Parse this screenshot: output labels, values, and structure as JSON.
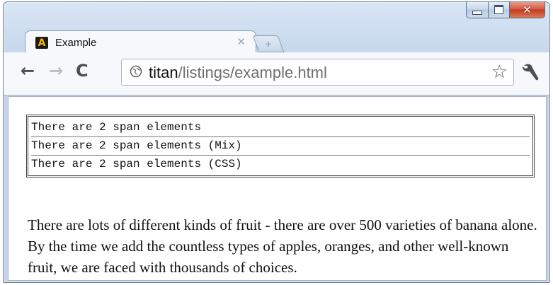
{
  "window": {
    "tab": {
      "title": "Example",
      "favicon_letter": "A"
    },
    "controls": {
      "minimize": "minimize",
      "maximize": "maximize",
      "close": "close"
    }
  },
  "toolbar": {
    "url_host": "titan",
    "url_path": "/listings/example.html",
    "icons": [
      "back-arrow-icon",
      "forward-arrow-icon",
      "reload-icon",
      "globe-icon",
      "star-icon",
      "wrench-icon"
    ]
  },
  "content": {
    "code_lines": [
      "There are 2 span elements",
      "There are 2 span elements (Mix)",
      "There are 2 span elements (CSS)"
    ],
    "paragraph": "There are lots of different kinds of fruit - there are over 500 varieties of banana alone. By the time we add the countless types of apples, oranges, and other well-known fruit, we are faced with thousands of choices."
  },
  "colors": {
    "chrome_frame": "#c9daee",
    "close_button": "#d2553c",
    "favicon_bg": "#1a1a1a",
    "favicon_letter": "#f2b400"
  }
}
